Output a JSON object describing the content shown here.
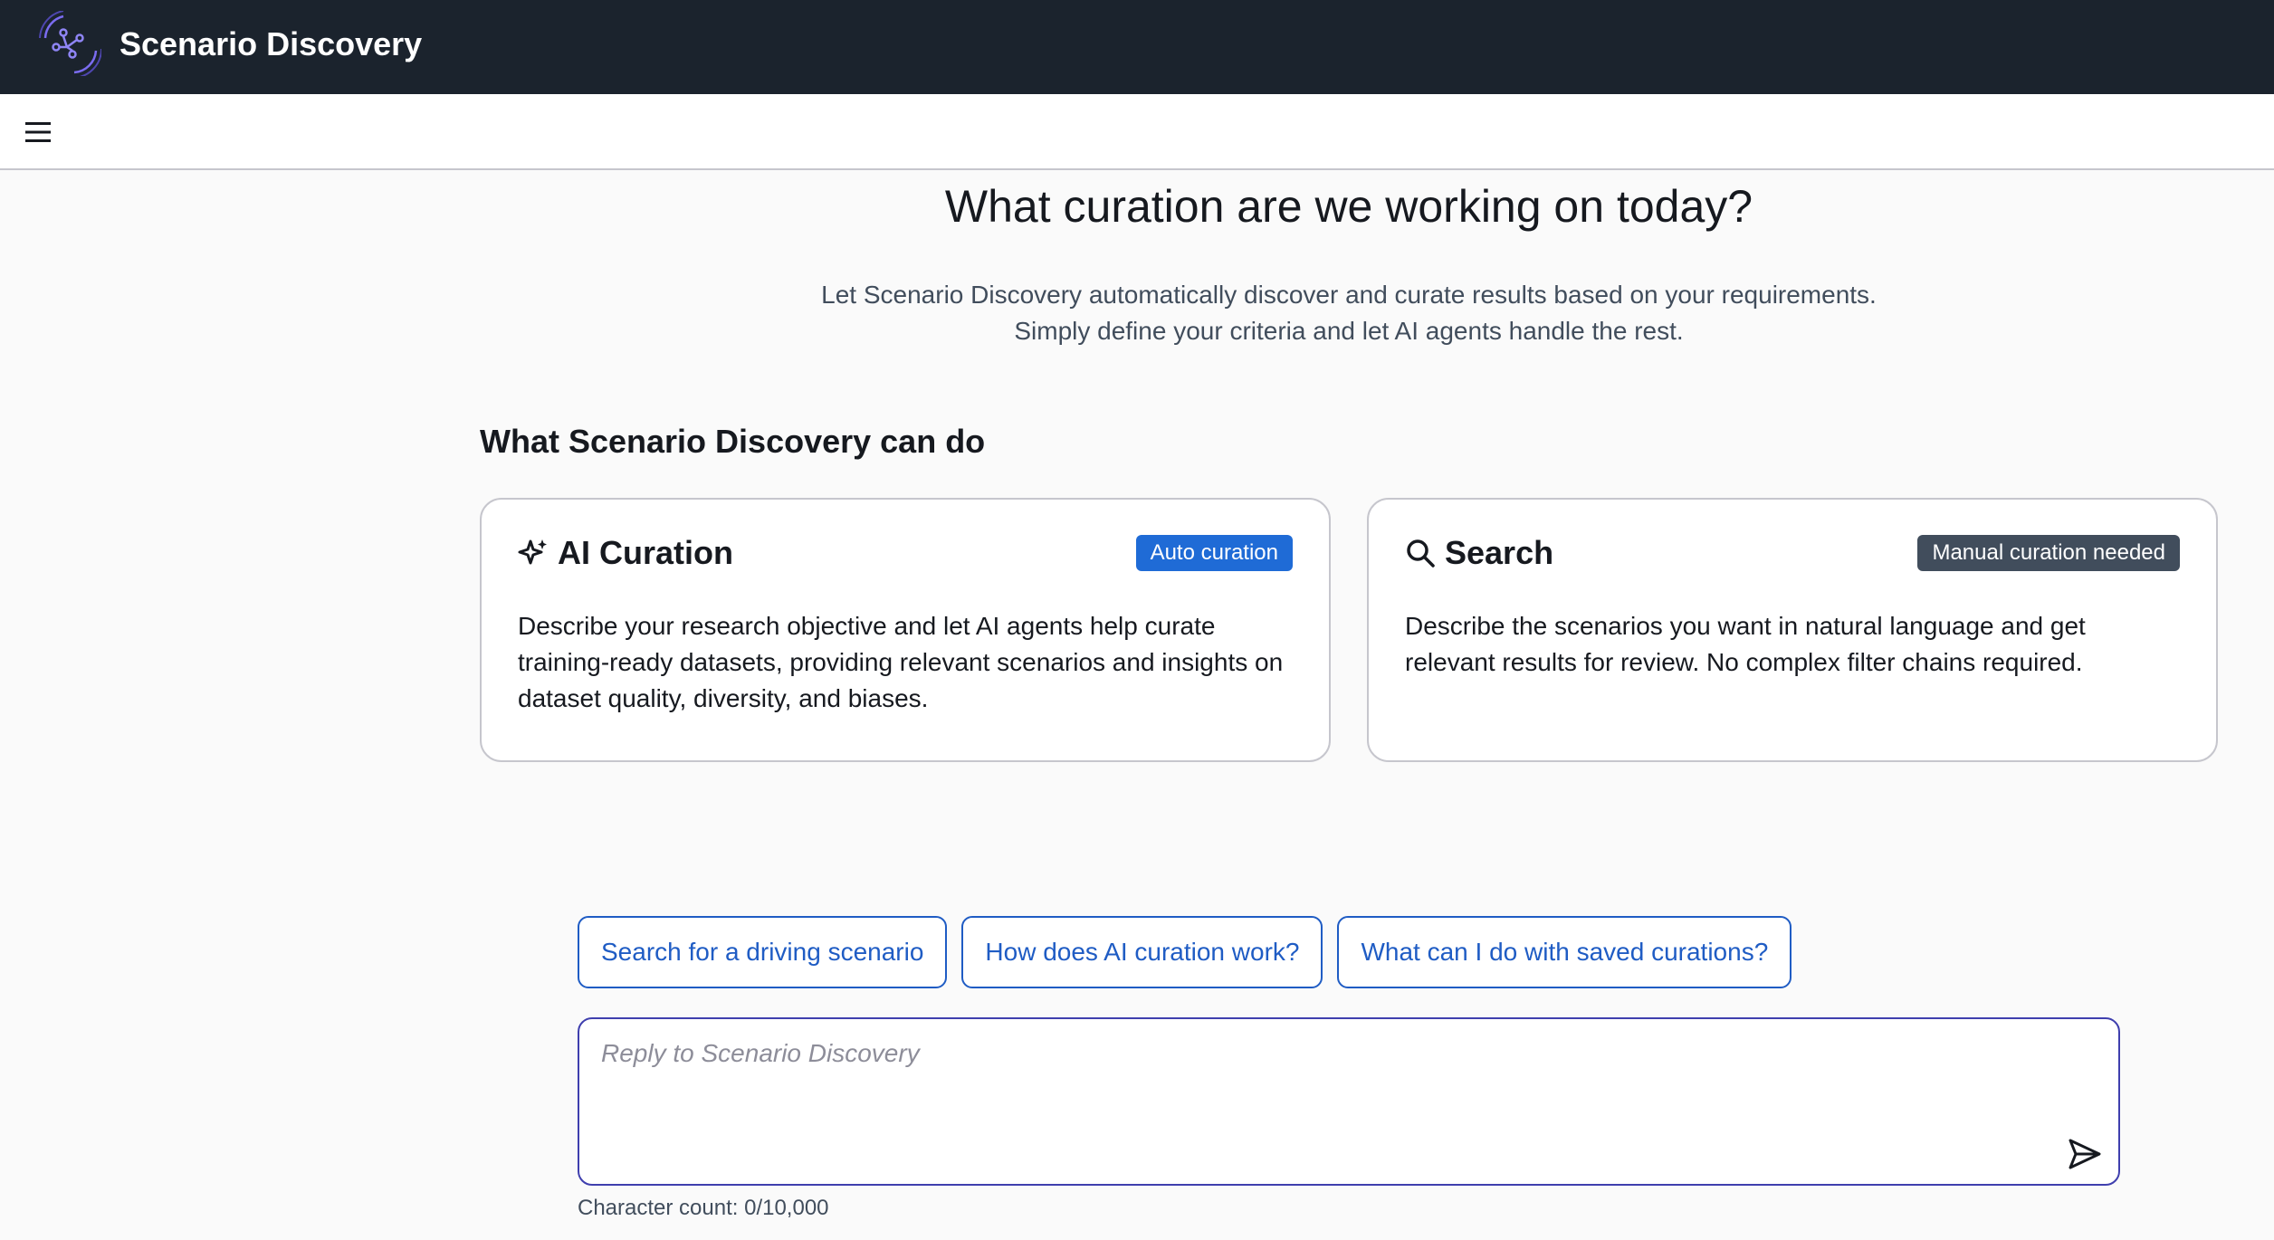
{
  "header": {
    "app_title": "Scenario Discovery",
    "logo_icon": "scenario-discovery-logo-icon",
    "background": "#1b232d"
  },
  "toolbar": {
    "menu_icon": "hamburger-menu-icon"
  },
  "main": {
    "heading": "What curation are we working on today?",
    "intro_line1": "Let Scenario Discovery automatically discover and curate results based on your requirements.",
    "intro_line2": "Simply define your criteria and let AI agents handle the rest.",
    "section_title": "What Scenario Discovery can do"
  },
  "cards": [
    {
      "title": "AI Curation",
      "icon": "sparkle-icon",
      "badge": "Auto curation",
      "badge_color": "#1f6bd6",
      "text": "Describe your research objective and let AI agents help curate training-ready datasets, providing relevant scenarios and insights on dataset quality, diversity, and biases."
    },
    {
      "title": "Search",
      "icon": "search-icon",
      "badge": "Manual curation needed",
      "badge_color": "#414d5c",
      "text": "Describe the scenarios you want in natural language and get relevant results for review. No complex filter chains required."
    }
  ],
  "suggestions": [
    "Search for a driving scenario",
    "How does AI curation work?",
    "What can I do with saved curations?"
  ],
  "input": {
    "placeholder": "Reply to Scenario Discovery",
    "value": "",
    "send_icon": "send-icon",
    "border_color": "#3f3fae"
  },
  "char_count": "Character count: 0/10,000",
  "colors": {
    "link": "#1f5cc4",
    "page_bg": "#fafafa"
  }
}
